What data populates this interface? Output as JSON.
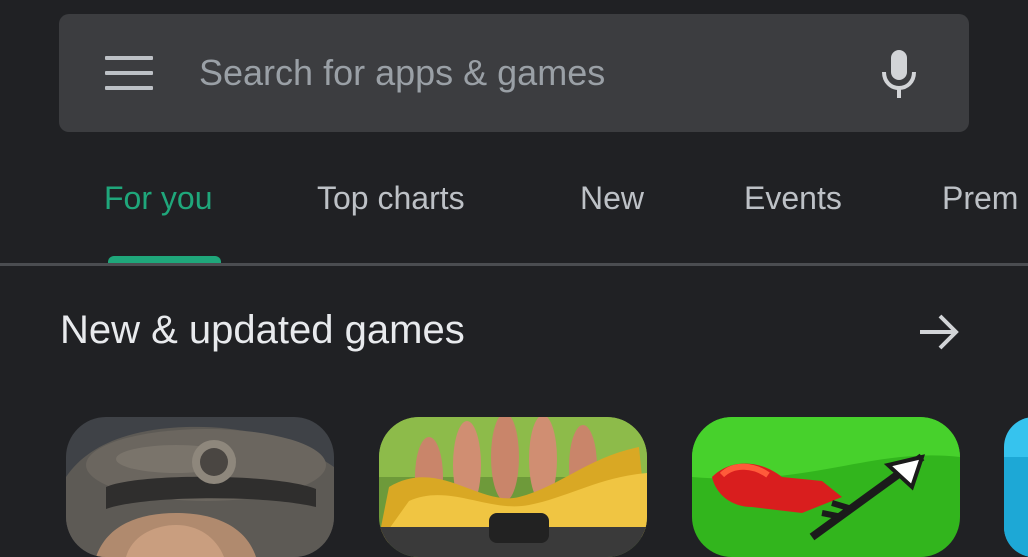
{
  "search": {
    "placeholder": "Search for apps & games",
    "menu_icon": "hamburger-menu-icon",
    "mic_icon": "microphone-icon"
  },
  "tabs": [
    {
      "label": "For you",
      "active": true
    },
    {
      "label": "Top charts",
      "active": false
    },
    {
      "label": "New",
      "active": false
    },
    {
      "label": "Events",
      "active": false
    },
    {
      "label": "Prem",
      "active": false
    }
  ],
  "section": {
    "title": "New & updated games",
    "arrow_icon": "arrow-right-icon"
  },
  "colors": {
    "background": "#202124",
    "search_bar": "#3c3d40",
    "accent": "#1fa77b",
    "text_primary": "#e8eaed",
    "text_secondary": "#bdc1c6"
  }
}
